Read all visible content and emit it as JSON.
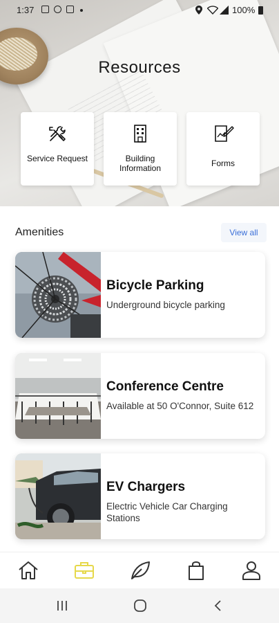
{
  "status_bar": {
    "time": "1:37",
    "battery": "100%"
  },
  "hero": {
    "title": "Resources"
  },
  "resources": [
    {
      "label": "Service Request",
      "icon": "tools-icon"
    },
    {
      "label": "Building Information",
      "icon": "building-icon"
    },
    {
      "label": "Forms",
      "icon": "form-icon"
    }
  ],
  "amenities": {
    "title": "Amenities",
    "view_all": "View all",
    "items": [
      {
        "title": "Bicycle Parking",
        "subtitle": "Underground bicycle parking"
      },
      {
        "title": "Conference Centre",
        "subtitle": "Available at 50 O'Connor, Suite 612"
      },
      {
        "title": "EV Chargers",
        "subtitle": "Electric Vehicle Car Charging Stations"
      }
    ]
  },
  "bottom_nav": {
    "items": [
      "home-icon",
      "briefcase-icon",
      "leaf-icon",
      "shopping-bag-icon",
      "profile-icon"
    ],
    "active_color": "#e6d84a",
    "inactive_color": "#333333"
  },
  "colors": {
    "link": "#3a6fd8",
    "active_nav": "#e6d84a"
  }
}
